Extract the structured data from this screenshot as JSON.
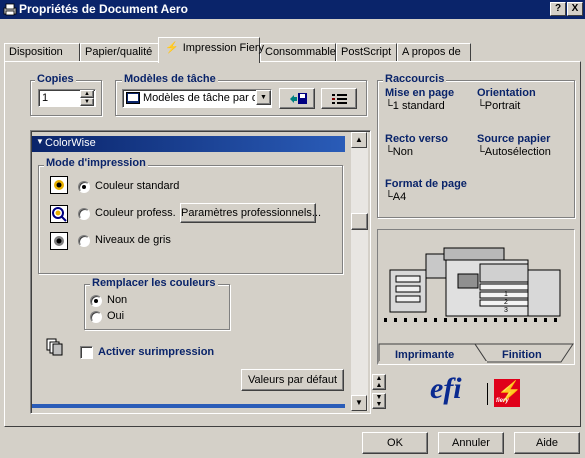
{
  "window": {
    "title": "Propriétés de Document Aero",
    "help_btn": "?",
    "close_btn": "X"
  },
  "tabs": [
    {
      "label": "Disposition"
    },
    {
      "label": "Papier/qualité"
    },
    {
      "label": "Impression Fiery"
    },
    {
      "label": "Consommables"
    },
    {
      "label": "PostScript"
    },
    {
      "label": "A propos de"
    }
  ],
  "copies": {
    "label": "Copies",
    "value": "1"
  },
  "job_templates": {
    "label": "Modèles de tâche",
    "selected": "Modèles de tâche par d"
  },
  "colorwise": {
    "header": "ColorWise",
    "print_mode": {
      "label": "Mode d'impression",
      "options": [
        "Couleur standard",
        "Couleur profess.",
        "Niveaux de gris"
      ],
      "selected": "Couleur standard",
      "pro_params_button": "Paramètres professionnels..."
    },
    "replace_colors": {
      "label": "Remplacer les couleurs",
      "options": [
        "Non",
        "Oui"
      ],
      "selected": "Non"
    },
    "overprint": {
      "label": "Activer surimpression",
      "checked": false
    },
    "defaults_button": "Valeurs par défaut"
  },
  "shortcuts": {
    "title": "Raccourcis",
    "items": [
      {
        "label": "Mise en page",
        "value": "1 standard"
      },
      {
        "label": "Orientation",
        "value": "Portrait"
      },
      {
        "label": "Recto verso",
        "value": "Non"
      },
      {
        "label": "Source papier",
        "value": "Autosélection"
      },
      {
        "label": "Format de page",
        "value": "A4"
      }
    ]
  },
  "printer_tabs": {
    "printer": "Imprimante",
    "finishing": "Finition"
  },
  "logo": {
    "efi": "efi",
    "fiery": "fiery"
  },
  "footer": {
    "ok": "OK",
    "cancel": "Annuler",
    "help": "Aide"
  }
}
